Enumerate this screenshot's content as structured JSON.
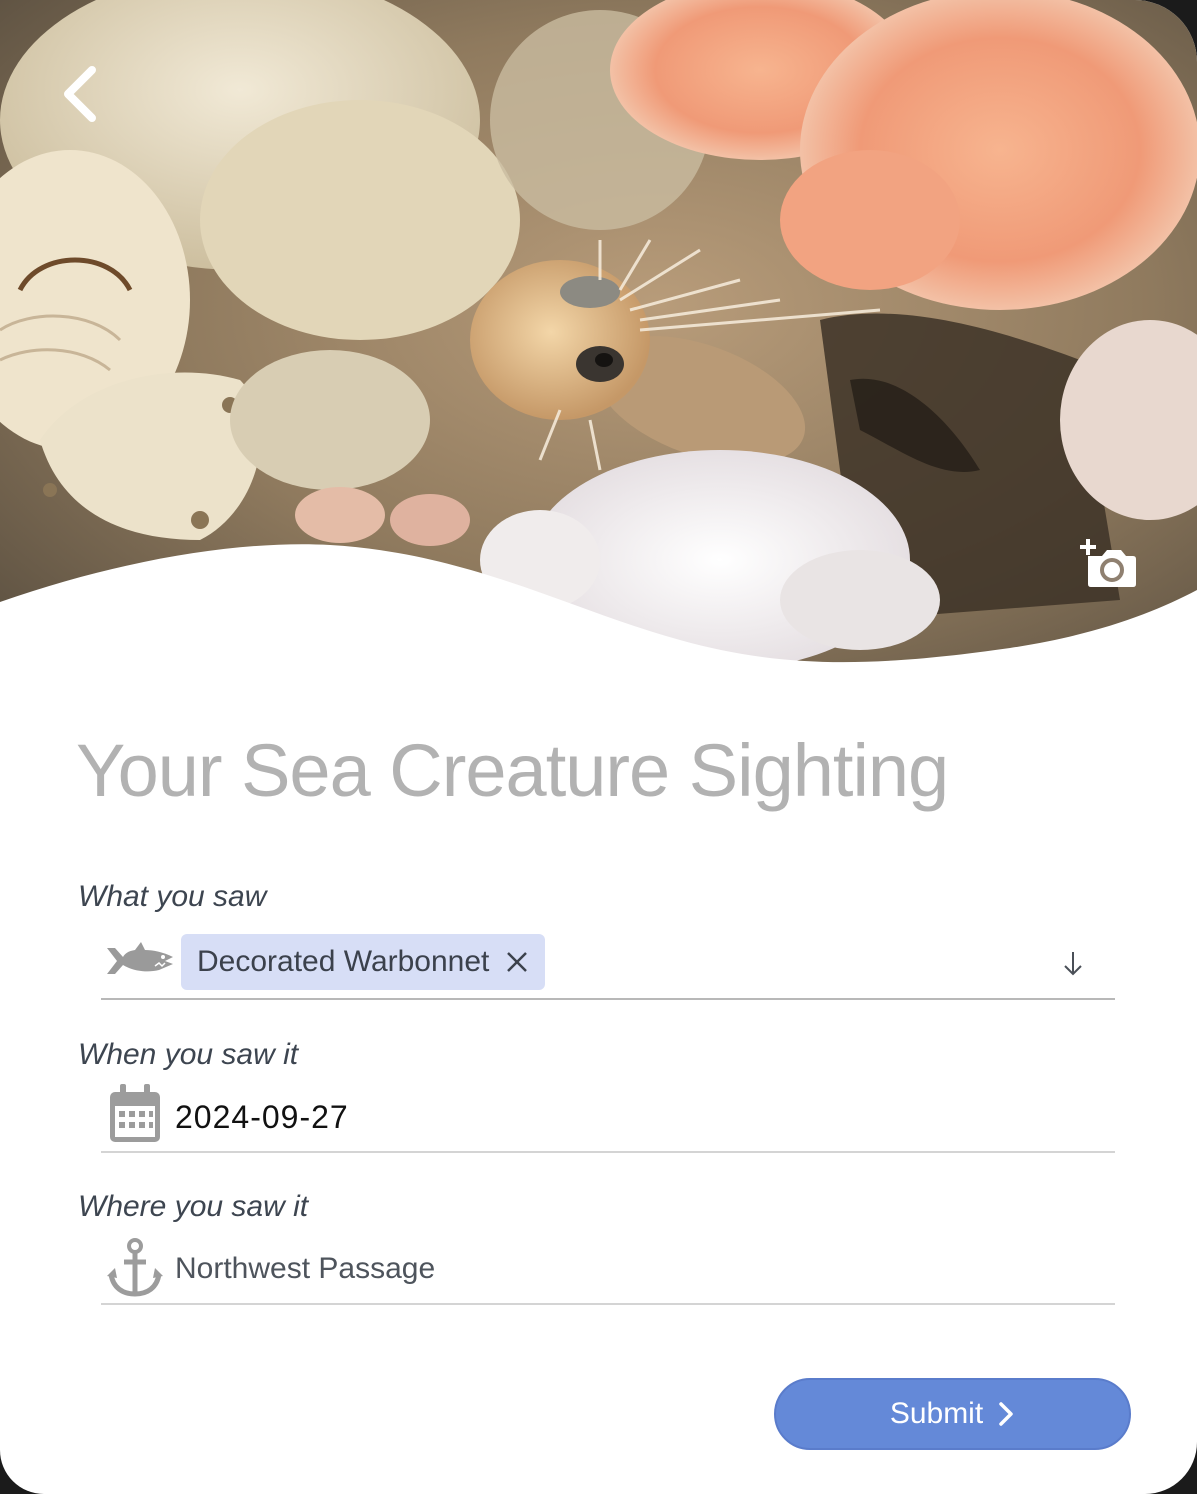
{
  "hero": {
    "photo_subject": "decorated-warbonnet-photo",
    "back_icon": "chevron-left-icon",
    "add_photo_icon": "add-photo-camera-icon"
  },
  "page": {
    "title": "Your Sea Creature Sighting"
  },
  "form": {
    "what": {
      "label": "What you saw",
      "icon": "shark-icon",
      "selected": "Decorated Warbonnet",
      "remove_icon": "close-icon",
      "dropdown_icon": "arrow-down-icon"
    },
    "when": {
      "label": "When you saw it",
      "icon": "calendar-icon",
      "value": "2024-09-27"
    },
    "where": {
      "label": "Where you saw it",
      "icon": "anchor-icon",
      "value": "Northwest Passage"
    },
    "submit": {
      "label": "Submit",
      "icon": "chevron-right-icon"
    }
  },
  "colors": {
    "accent": "#6489d8",
    "chip": "#d7def6",
    "title": "#b2b2b2"
  }
}
